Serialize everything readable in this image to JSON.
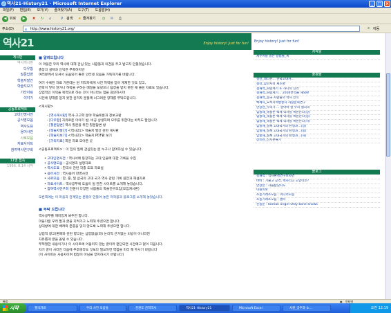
{
  "window": {
    "title": "역사21-History21 - Microsoft Internet Explorer"
  },
  "menubar": [
    "파일(F)",
    "편집(E)",
    "보기(V)",
    "즐겨찾기(A)",
    "도구(T)",
    "도움말(H)"
  ],
  "toolbar": {
    "back": "뒤로",
    "search": "검색",
    "favorites": "즐겨찾기"
  },
  "address": {
    "label": "주소(D)",
    "url": "http://www.history21.org/",
    "go": "이동"
  },
  "site": {
    "logo": "역사21",
    "slogan": "Enjoy history! Just for fun!"
  },
  "leftnav": {
    "sections": [
      {
        "header": "게시판",
        "items": [
          {
            "label": "역사게시판",
            "state": "dim"
          },
          {
            "label": "다우함"
          },
          {
            "label": "질문답변"
          },
          {
            "label": "학술지발간"
          },
          {
            "label": "학술지보기"
          },
          {
            "label": "기타자료"
          },
          {
            "label": "이야기"
          }
        ]
      },
      {
        "header": "공동프로젝트",
        "items": [
          {
            "label": "고대인명사전"
          },
          {
            "label": "공식명모음"
          },
          {
            "label": "역사도표"
          },
          {
            "label": "용어사전"
          },
          {
            "label": "사로모음",
            "state": "current"
          },
          {
            "label": "자료사이트"
          },
          {
            "label": "참여역사연구회"
          }
        ]
      },
      {
        "header": "11명 접속",
        "items": [
          {
            "label": "1996. 8.14 시작",
            "state": "dim"
          }
        ]
      }
    ]
  },
  "main": {
    "intro_head": "■ 알려드립니다",
    "intro": [
      "이 마을은 우리 역사에 대해 관심 있는 사람들과 의견을 주고 받고자 만들었습니다.",
      "총장의 설쳐과 인덕은 부족하지만",
      "여러분께서 모셔서 도움되어 좋은 인터넷 모음을 가득하기를 바랍니다.",
      "",
      "여기 수록된 자료 가운데는 원 저작자에게 사전 허락을 얻어 게재한 것도 있고,",
      "연락이 닿지 않거나 허락을 구하는 메일을 보냈으나 답장을 받지 못한 채 올린 자료도 있습니다.",
      "상업적인 이익을 목적으로 하는 것이 아니라는 점을 감안하시어",
      "사전에 양해를 얻지 못한 원저자 분들께 너그러운 양해를 부탁드립니다."
    ],
    "board_label": "<게시판>",
    "board_items": [
      {
        "key": "[역사게시판]",
        "text": " 역사-고고학 분야 학술토론과 정보교환"
      },
      {
        "key": "[다우함]",
        "text": " 자유로운 이야기 방, 비공 상생하며 모두를 위한다는 바두도 말입니다."
      },
      {
        "key": "[질문답변]",
        "text": " 역사 질문을 위한 질문답변 방"
      },
      {
        "key": "[학술지발간]",
        "text": " <역사21> 학술지 발간 관련 게시판"
      },
      {
        "key": "[학술지보기]",
        "text": " <역사21> 학술지 PDF판 보기"
      },
      {
        "key": "[기타자료]",
        "text": " 회원 자료 모아둔 곳"
      }
    ],
    "project_label": "<공동프로젝트> : 이 집의 일에 관심있는 분 누구나 참여하실 수 있습니다.",
    "project_items": [
      {
        "key": "고대인명사전",
        "text": " : 역사서에 등장하는 고대 인물에 대한 기록을 수집"
      },
      {
        "key": "공식명모음",
        "text": " : 공식명과 설명자료"
      },
      {
        "key": "역사도표",
        "text": " : 한국사 관련 각종 도표 자료실"
      },
      {
        "key": "용어사전",
        "text": " : 역사용어 한영사전"
      },
      {
        "key": "사로모음",
        "text": " : 한, 중, 일 삼국의 고대 국가 역사 관련 기록 원전과 해설자료"
      },
      {
        "key": "자료사이트",
        "text": " : 역사공부에 도움이 될 만한 사이트를 소개해 놓았습니다."
      },
      {
        "key": "참여역사연구회",
        "text": " 전문이 다양한 사람들의 학술연구모임(모임게시판)"
      }
    ],
    "footer_note": "오른쪽에는 이 마을과 관계있는 분들이 만들어 놓은 저작물과 블로그를 소개해 놓았습니다.",
    "request_head": "■ 부탁 드립니다",
    "request": [
      "역사공부를 재미있게 봐주면 합니다.",
      "마을다운 우리 말과 글을 지켜가고 노력해 주셨으면 합니다.",
      "상대방에 대한 배려와 존중을 잊지 않도록 노력해 주셨으면 합니다.",
      "",
      "상업적 광고(판매와 관련 향고)는 삼양없음(와) 논리적 근거없는 비방이 아니라면",
      "자유롭게 글을 올릴 수 있습니다.",
      "부적절한 내용이거나 이 사이트에 어울리지 않는 글이라 판단되면 사전예고 없이 지웁니다.",
      "자기 글이 사라진 다음에 추후에라도 것보다 필요하면 역점을 미리 해 두시기 바랍니다",
      "(이 사이트는 사용자이며 법정이 아님을 양지하시기 바랍니다)"
    ]
  },
  "right": {
    "top_link": "Enjoy history! Just for fun!",
    "boxes": [
      {
        "header": "저작물",
        "items": [
          "제주어를 읽는 방법들_씨"
        ]
      },
      {
        "header": "출판물",
        "items": [
          "검산_네티즌... 한국고대사...",
          "검산_삼한사의 재조명",
          "검재석_화랑세기 또 하나의 신라",
          "검재석_화랑세기... 2004번역을 해외판",
          "검재석_중국 사람들의 역사 인식",
          "백제사_요서지역방송사 사찰문화연구",
          "안상현_우리가 ... 알아야 할 우리 별자리",
          "임할해_해를뜬 백제 역사를 복원한다(상)",
          "임할해_해를뜬 백제 역사를 복원한다(중)",
          "임할해_해를뜬 백제 역사를 복원한다(하)",
          "임할해_실록 고대국가의 탄생과...(상)",
          "임할해_실록 고대국가의 탄생과...(중)",
          "임할해_실록 고대국가의 탄생과...(하)",
          "장유관_신시본류기"
        ]
      },
      {
        "header": "블로그",
        "items": [
          "김재석 : 역사환경연구보자연",
          "바바 : 기술고 공격, 백사리고 고양이는?",
          "안상헌 : 하늘탐닷지도",
          "이원이보",
          "소봉기래소모음 : 미디어모음",
          "소봉기래소모음 : 센터",
          "신봉문 : Korean origin-Only bone knows"
        ]
      }
    ]
  },
  "status": {
    "left": "완료",
    "zone": "인터넷"
  },
  "taskbar": {
    "start": "시작",
    "tasks": [
      "월국자료",
      "우리 사진 모음들",
      "감원도 감역역사",
      "역사21-History21",
      "Microsoft Excel",
      "사원_공주과 소..."
    ],
    "clock": "오전 12:19"
  }
}
